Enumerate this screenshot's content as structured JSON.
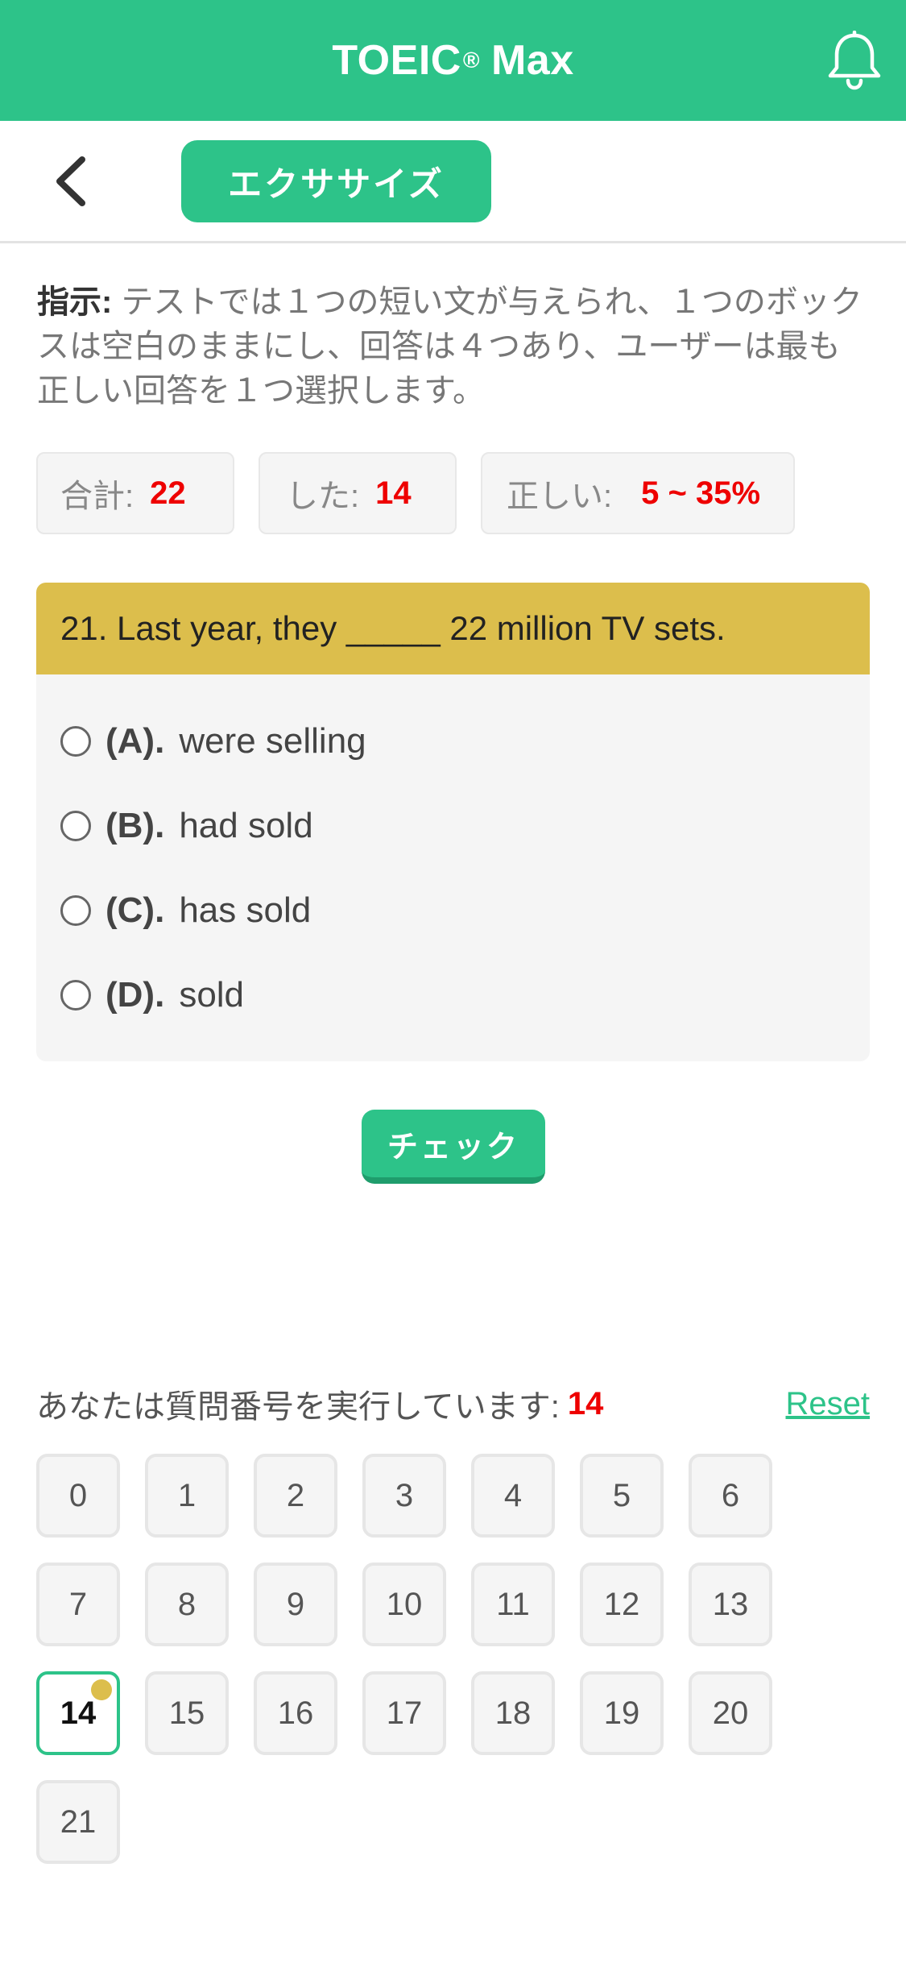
{
  "app": {
    "title": "TOEIC",
    "title_mark": "®",
    "title_suffix": "Max"
  },
  "icons": {
    "bell": "bell-icon",
    "back": "chevron-left-icon"
  },
  "colors": {
    "brand": "#2dc389",
    "question_header": "#dcbe4c",
    "highlight": "#e00000"
  },
  "subbar": {
    "tab_label": "エクササイズ"
  },
  "instructions": {
    "label": "指示:",
    "text": " テストでは１つの短い文が与えられ、１つのボックスは空白のままにし、回答は４つあり、ユーザーは最も正しい回答を１つ選択します。"
  },
  "stats": {
    "total_label": "合計:",
    "total_value": "22",
    "done_label": "した:",
    "done_value": "14",
    "correct_label": "正しい:",
    "correct_value": "5 ~ 35%"
  },
  "question": {
    "text": "21. Last year, they _____ 22 million TV sets.",
    "options": [
      {
        "letter": "(A).",
        "text": "were selling"
      },
      {
        "letter": "(B).",
        "text": "had sold"
      },
      {
        "letter": "(C).",
        "text": "has sold"
      },
      {
        "letter": "(D).",
        "text": "sold"
      }
    ]
  },
  "check_label": "チェック",
  "progress": {
    "label": "あなたは質問番号を実行しています:",
    "current": "14",
    "reset_label": "Reset"
  },
  "question_numbers": [
    "0",
    "1",
    "2",
    "3",
    "4",
    "5",
    "6",
    "7",
    "8",
    "9",
    "10",
    "11",
    "12",
    "13",
    "14",
    "15",
    "16",
    "17",
    "18",
    "19",
    "20",
    "21"
  ]
}
